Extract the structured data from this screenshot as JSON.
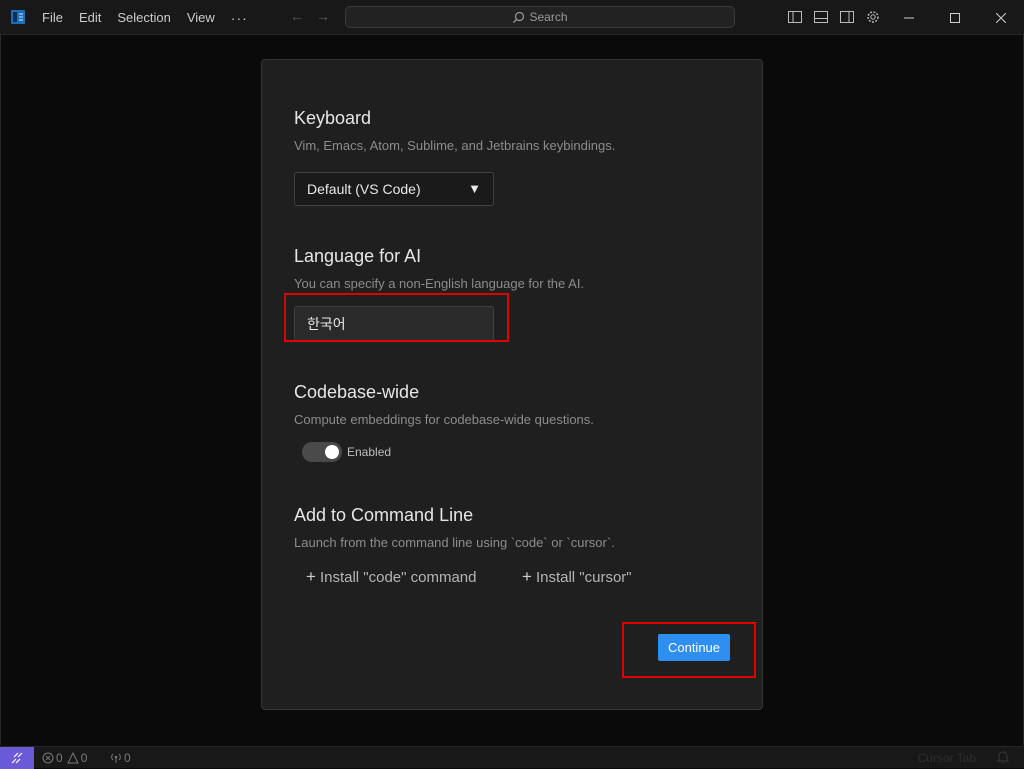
{
  "titlebar": {
    "menu": [
      "File",
      "Edit",
      "Selection",
      "View"
    ],
    "more": "···",
    "search_placeholder": "Search"
  },
  "dialog": {
    "keyboard": {
      "title": "Keyboard",
      "description": "Vim, Emacs, Atom, Sublime, and Jetbrains keybindings.",
      "selected": "Default (VS Code)"
    },
    "language": {
      "title": "Language for AI",
      "description": "You can specify a non-English language for the AI.",
      "value": "한국어"
    },
    "codebase": {
      "title": "Codebase-wide",
      "description": "Compute embeddings for codebase-wide questions.",
      "toggle_label": "Enabled",
      "enabled": true
    },
    "command_line": {
      "title": "Add to Command Line",
      "description": "Launch from the command line using `code` or `cursor`.",
      "install_code": "Install \"code\" command",
      "install_cursor": "Install \"cursor\""
    },
    "continue_label": "Continue"
  },
  "statusbar": {
    "errors": "0",
    "warnings": "0",
    "ports": "0",
    "right_text": "Cursor Tab"
  },
  "colors": {
    "accent": "#2f8ff0",
    "highlight": "#e00000",
    "remote": "#6b5ad8"
  }
}
